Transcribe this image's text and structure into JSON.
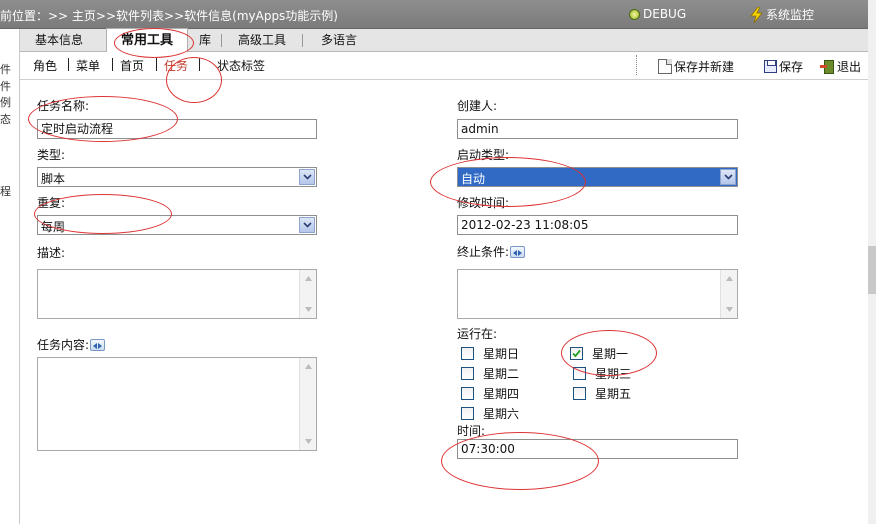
{
  "header": {
    "breadcrumb": "前位置：>> 主页>>软件列表>>软件信息(myApps功能示例)",
    "debug_label": "DEBUG",
    "monitor_label": "系统监控"
  },
  "tabs": [
    {
      "label": "基本信息"
    },
    {
      "label": "常用工具"
    },
    {
      "label": "库"
    },
    {
      "label": "高级工具"
    },
    {
      "label": "多语言"
    }
  ],
  "subnav": [
    {
      "label": "角色"
    },
    {
      "label": "菜单"
    },
    {
      "label": "首页"
    },
    {
      "label": "任务"
    },
    {
      "label": "状态标签"
    }
  ],
  "actions": {
    "save_new": "保存并新建",
    "save": "保存",
    "exit": "退出"
  },
  "leftstrip": [
    "件",
    "件",
    "例",
    "态",
    "程"
  ],
  "form": {
    "task_name": {
      "label": "任务名称:",
      "value": "定时启动流程"
    },
    "creator": {
      "label": "创建人:",
      "value": "admin"
    },
    "type": {
      "label": "类型:",
      "value": "脚本"
    },
    "start_type": {
      "label": "启动类型:",
      "value": "自动"
    },
    "repeat": {
      "label": "重复:",
      "value": "每周"
    },
    "modified_time": {
      "label": "修改时间:",
      "value": "2012-02-23 11:08:05"
    },
    "description": {
      "label": "描述:"
    },
    "end_condition": {
      "label": "终止条件:"
    },
    "task_content": {
      "label": "任务内容:"
    },
    "run_on": {
      "label": "运行在:"
    },
    "days": [
      {
        "label": "星期日",
        "checked": false
      },
      {
        "label": "星期一",
        "checked": true
      },
      {
        "label": "星期二",
        "checked": false
      },
      {
        "label": "星期三",
        "checked": false
      },
      {
        "label": "星期四",
        "checked": false
      },
      {
        "label": "星期五",
        "checked": false
      },
      {
        "label": "星期六",
        "checked": false
      }
    ],
    "time": {
      "label": "时间:",
      "value": "07:30:00"
    }
  },
  "colors": {
    "annotation": "#d33333",
    "highlight": "#316ac5",
    "active_subnav": "#c0392b"
  }
}
